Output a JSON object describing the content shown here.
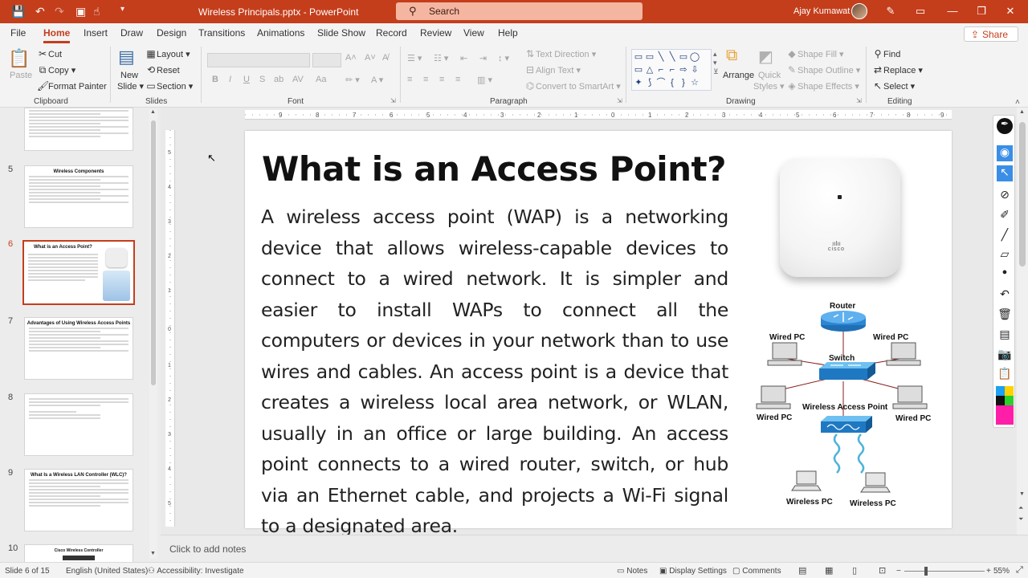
{
  "titlebar": {
    "doc_title": "Wireless Principals.pptx  -  PowerPoint",
    "search_placeholder": "Search",
    "user_name": "Ajay Kumawat"
  },
  "menu": {
    "tabs": [
      "File",
      "Home",
      "Insert",
      "Draw",
      "Design",
      "Transitions",
      "Animations",
      "Slide Show",
      "Record",
      "Review",
      "View",
      "Help"
    ],
    "active_tab": "Home",
    "share_label": "Share"
  },
  "ribbon": {
    "clipboard": {
      "paste": "Paste",
      "cut": "Cut",
      "copy": "Copy",
      "format_painter": "Format Painter",
      "group": "Clipboard"
    },
    "slides": {
      "new_slide_1": "New",
      "new_slide_2": "Slide",
      "layout": "Layout",
      "reset": "Reset",
      "section": "Section",
      "group": "Slides"
    },
    "font": {
      "bold": "B",
      "italic": "I",
      "underline": "U",
      "strike": "S",
      "spacing": "AV",
      "case": "Aa",
      "group": "Font"
    },
    "paragraph": {
      "text_direction": "Text Direction",
      "align_text": "Align Text",
      "smartart": "Convert to SmartArt",
      "group": "Paragraph"
    },
    "drawing": {
      "arrange": "Arrange",
      "quick_styles_1": "Quick",
      "quick_styles_2": "Styles",
      "shape_fill": "Shape Fill",
      "shape_outline": "Shape Outline",
      "shape_effects": "Shape Effects",
      "group": "Drawing"
    },
    "editing": {
      "find": "Find",
      "replace": "Replace",
      "select": "Select",
      "group": "Editing"
    }
  },
  "thumbnails": [
    {
      "num": "",
      "title": ""
    },
    {
      "num": "5",
      "title": "Wireless Components"
    },
    {
      "num": "6",
      "title": "What is an Access Point?"
    },
    {
      "num": "7",
      "title": "Advantages of Using Wireless Access Points"
    },
    {
      "num": "8",
      "title": ""
    },
    {
      "num": "9",
      "title": "What Is a Wireless LAN Controller (WLC)?"
    },
    {
      "num": "10",
      "title": "Cisco Wireless Controller"
    }
  ],
  "slide": {
    "title": "What is an Access Point?",
    "body": "A wireless access point (WAP) is a networking device that allows wireless-capable devices to connect to a wired network. It is simpler and easier to install WAPs to connect all the computers or devices in your network than to use wires and cables. An access point is a device that creates a wireless local area network, or WLAN, usually in an office or large building. An access point connects to a wired router, switch, or hub via an Ethernet cable, and projects a Wi-Fi signal to a designated area.",
    "device_logo": "cisco",
    "diagram_labels": {
      "router": "Router",
      "switch": "Switch",
      "wired_pc": "Wired PC",
      "wap": "Wireless Access Point",
      "wireless_pc": "Wireless PC"
    }
  },
  "notes": {
    "placeholder": "Click to add notes"
  },
  "status": {
    "slide_count": "Slide 6 of 15",
    "language": "English (United States)",
    "accessibility": "Accessibility: Investigate",
    "notes": "Notes",
    "display_settings": "Display Settings",
    "comments": "Comments",
    "zoom": "55%",
    "zoom_fraction": 0.55
  },
  "colors": {
    "accent": "#c43e1c",
    "search_bg": "#f5b6a1"
  }
}
